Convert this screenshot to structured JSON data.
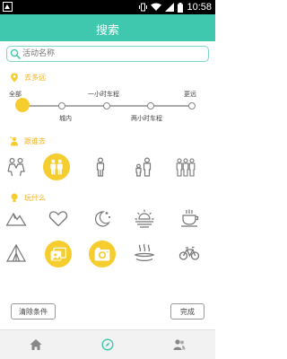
{
  "status_bar": {
    "time": "10:58"
  },
  "header": {
    "title": "搜索"
  },
  "search": {
    "placeholder": "活动名称"
  },
  "distance": {
    "title": "去多远",
    "selected_value": "全部",
    "labels": {
      "all": "全部",
      "within_city": "城内",
      "one_hour": "一小时车程",
      "two_hours": "两小时车程",
      "farther": "更远"
    }
  },
  "companions": {
    "title": "跟谁去",
    "items": [
      {
        "icon": "couple-icon",
        "selected": false
      },
      {
        "icon": "friends-icon",
        "selected": true
      },
      {
        "icon": "single-person-icon",
        "selected": false
      },
      {
        "icon": "parent-child-icon",
        "selected": false
      },
      {
        "icon": "group-icon",
        "selected": false
      }
    ]
  },
  "activities": {
    "title": "玩什么",
    "items": [
      {
        "icon": "mountain-icon",
        "selected": false
      },
      {
        "icon": "heart-icon",
        "selected": false
      },
      {
        "icon": "moon-stars-icon",
        "selected": false
      },
      {
        "icon": "sunrise-icon",
        "selected": false
      },
      {
        "icon": "coffee-cup-icon",
        "selected": false
      },
      {
        "icon": "tent-icon",
        "selected": false
      },
      {
        "icon": "photo-album-icon",
        "selected": true
      },
      {
        "icon": "camera-icon",
        "selected": true
      },
      {
        "icon": "hot-spring-icon",
        "selected": false
      },
      {
        "icon": "bicycle-icon",
        "selected": false
      }
    ]
  },
  "actions": {
    "clear": "清除条件",
    "done": "完成"
  },
  "bottom_nav": {
    "items": [
      {
        "icon": "home-icon",
        "active": false
      },
      {
        "icon": "compass-icon",
        "active": true
      },
      {
        "icon": "contacts-icon",
        "active": false
      }
    ]
  },
  "colors": {
    "accent": "#3fc8ad",
    "highlight": "#f5cd2f",
    "section_title": "#f2b21e"
  }
}
